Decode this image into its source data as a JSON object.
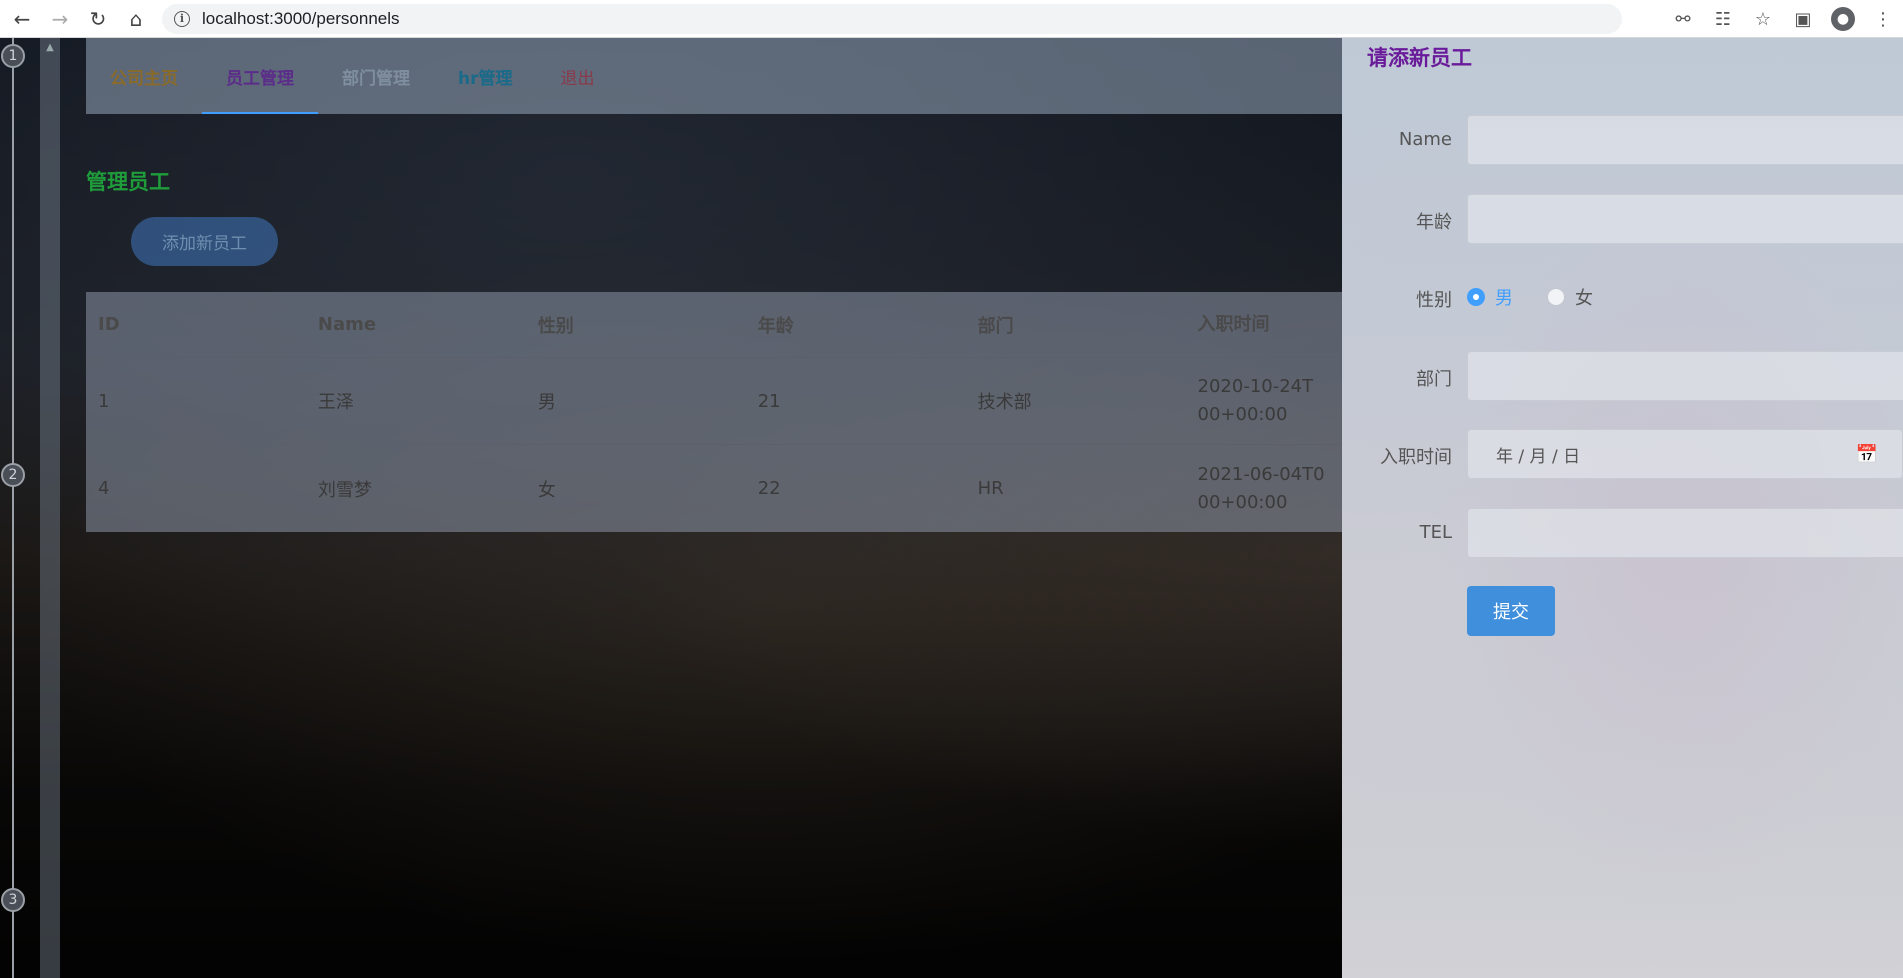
{
  "browser": {
    "url": "localhost:3000/personnels",
    "icons": [
      "back-icon",
      "forward-icon",
      "reload-icon",
      "home-icon",
      "info-icon",
      "key-icon",
      "translate-icon",
      "star-icon",
      "extensions-icon",
      "profile-icon"
    ]
  },
  "timeline": {
    "nodes": [
      "1",
      "2",
      "3"
    ]
  },
  "nav": {
    "items": [
      {
        "label": "公司主页",
        "color": "#8a6a2a"
      },
      {
        "label": "员工管理",
        "color": "#5b2c8a"
      },
      {
        "label": "部门管理",
        "color": "#7f8fa0"
      },
      {
        "label": "hr管理",
        "color": "#1a6a8a"
      },
      {
        "label": "退出",
        "color": "#8a3a4a"
      }
    ]
  },
  "main": {
    "title": "管理员工",
    "add_button": "添加新员工"
  },
  "table": {
    "headers": [
      "ID",
      "Name",
      "性别",
      "年龄",
      "部门",
      "入职时间"
    ],
    "rows": [
      [
        "1",
        "王泽",
        "男",
        "21",
        "技术部",
        "2020-10-24T\n00+00:00"
      ],
      [
        "4",
        "刘雪梦",
        "女",
        "22",
        "HR",
        "2021-06-04T0\n00+00:00"
      ]
    ]
  },
  "drawer": {
    "title": "请添新员工",
    "fields": {
      "name_label": "Name",
      "age_label": "年龄",
      "gender_label": "性别",
      "gender_options": [
        "男",
        "女"
      ],
      "gender_selected": "男",
      "dept_label": "部门",
      "date_label": "入职时间",
      "date_placeholder": "年 / 月 / 日",
      "tel_label": "TEL"
    },
    "submit": "提交"
  }
}
